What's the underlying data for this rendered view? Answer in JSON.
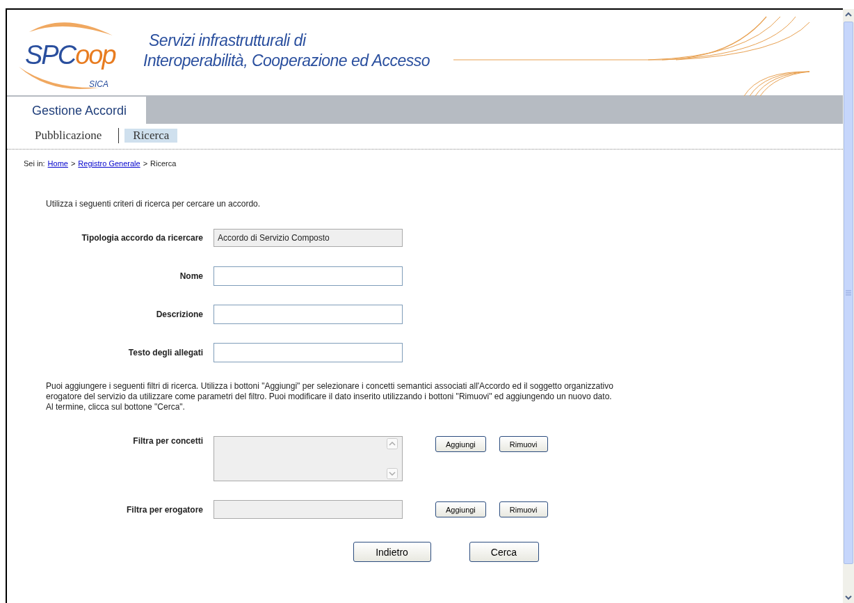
{
  "header": {
    "logo_main": "SPC",
    "logo_accent": "oop",
    "logo_sub": "SICA",
    "title_lines": [
      "Servizi infrastrutturali di",
      "Interoperabilità, Cooperazione ed Accesso"
    ]
  },
  "section_tab": {
    "label": "Gestione Accordi"
  },
  "subnav": [
    {
      "label": "Pubblicazione",
      "selected": false
    },
    {
      "label": "Ricerca",
      "selected": true
    }
  ],
  "breadcrumb": {
    "prefix": "Sei in:",
    "links": [
      "Home",
      "Registro Generale"
    ],
    "current": "Ricerca",
    "separator": ">"
  },
  "intro": "Utilizza i seguenti criteri di ricerca per cercare un accordo.",
  "fields": [
    {
      "label": "Tipologia accordo da ricercare",
      "value": "Accordo di Servizio Composto",
      "disabled": true
    },
    {
      "label": "Nome",
      "disabled": false
    },
    {
      "label": "Descrizione",
      "disabled": false
    },
    {
      "label": "Testo degli allegati",
      "disabled": false
    }
  ],
  "filters_help": [
    "Puoi aggiungere i seguenti filtri di ricerca. Utilizza i bottoni \"Aggiungi\" per selezionare i concetti semantici associati all'Accordo ed il soggetto organizzativo",
    "erogatore del servizio da utilizzare come parametri del filtro. Puoi modificare il dato inserito utilizzando i bottoni \"Rimuovi\" ed aggiungendo un nuovo dato.",
    "Al termine, clicca sul bottone \"Cerca\"."
  ],
  "filters": [
    {
      "label": "Filtra per concetti",
      "kind": "list",
      "buttons": [
        "Aggiungi",
        "Rimuovi"
      ]
    },
    {
      "label": "Filtra per erogatore",
      "kind": "single",
      "buttons": [
        "Aggiungi",
        "Rimuovi"
      ]
    }
  ],
  "actions": [
    "Indietro",
    "Cerca"
  ]
}
